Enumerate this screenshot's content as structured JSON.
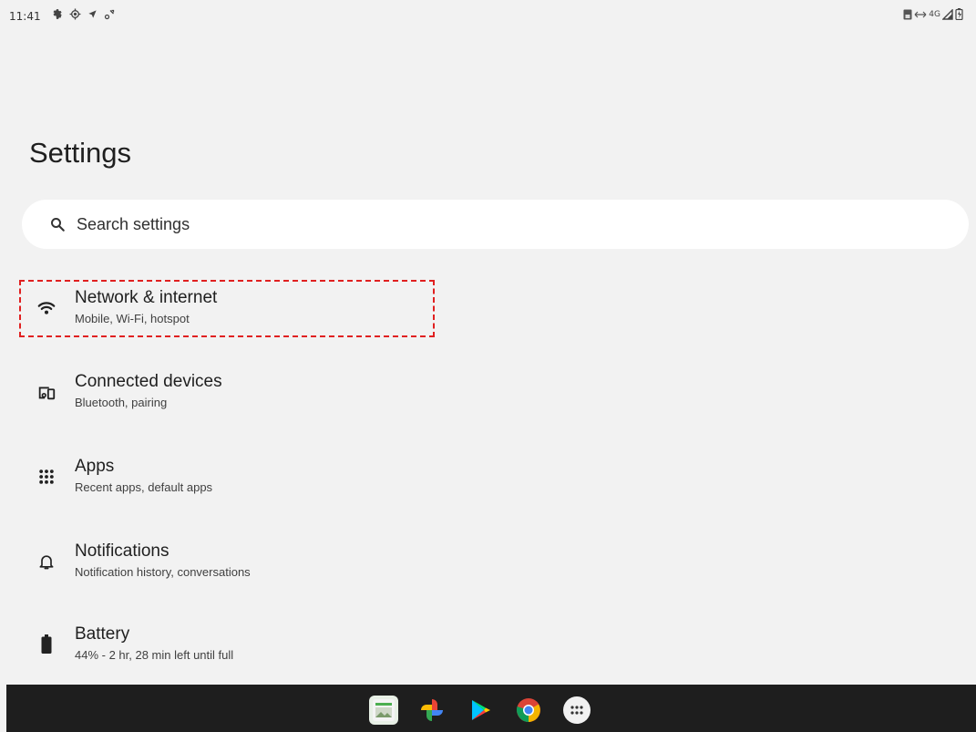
{
  "status_bar": {
    "time": "11:41",
    "left_icons": [
      "settings-icon",
      "gps-icon",
      "location-arrow-icon",
      "sync-icon"
    ],
    "network_label": "4G",
    "right_icons": [
      "sim-icon",
      "data-arrows-icon",
      "signal-icon",
      "battery-charging-icon"
    ]
  },
  "page": {
    "title": "Settings"
  },
  "search": {
    "placeholder": "Search settings"
  },
  "settings_items": [
    {
      "title": "Network & internet",
      "subtitle": "Mobile, Wi-Fi, hotspot",
      "icon": "wifi-icon",
      "highlighted": true
    },
    {
      "title": "Connected devices",
      "subtitle": "Bluetooth, pairing",
      "icon": "devices-icon"
    },
    {
      "title": "Apps",
      "subtitle": "Recent apps, default apps",
      "icon": "apps-grid-icon"
    },
    {
      "title": "Notifications",
      "subtitle": "Notification history, conversations",
      "icon": "bell-icon"
    },
    {
      "title": "Battery",
      "subtitle": "44% - 2 hr, 28 min left until full",
      "icon": "battery-icon"
    }
  ],
  "dock_apps": [
    "gallery-app",
    "photos-app",
    "play-store-app",
    "chrome-app",
    "app-drawer"
  ],
  "colors": {
    "background": "#f2f2f2",
    "highlight": "#e02020",
    "taskbar": "#1e1e1e"
  }
}
